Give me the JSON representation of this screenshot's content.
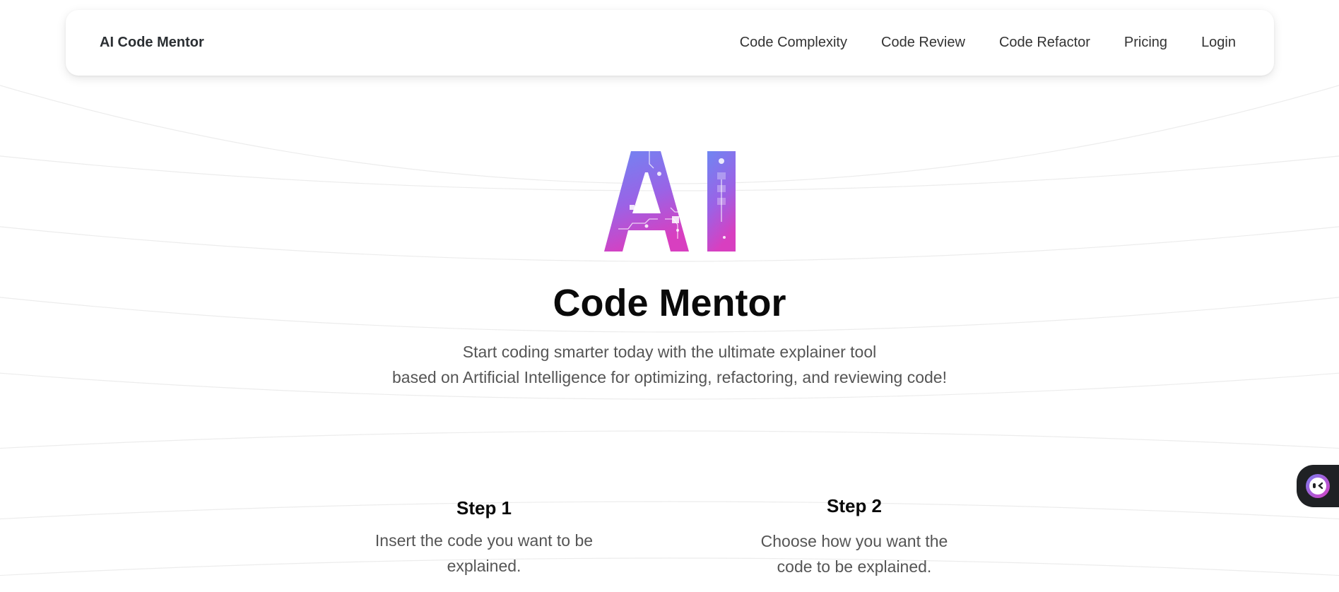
{
  "navbar": {
    "brand": "AI Code Mentor",
    "links": [
      {
        "label": "Code Complexity"
      },
      {
        "label": "Code Review"
      },
      {
        "label": "Code Refactor"
      },
      {
        "label": "Pricing"
      },
      {
        "label": "Login"
      }
    ]
  },
  "hero": {
    "logo_text": "AI",
    "title": "Code Mentor",
    "subtitle_line1": "Start coding smarter today with the ultimate explainer tool",
    "subtitle_line2": "based on Artificial Intelligence for optimizing, refactoring, and reviewing code!"
  },
  "steps": [
    {
      "title": "Step 1",
      "desc_line1": "Insert the code you want to be",
      "desc_line2": "explained."
    },
    {
      "title": "Step 2",
      "desc_line1": "Choose how you want the",
      "desc_line2": "code to be explained."
    }
  ],
  "chat_widget": {
    "icon": "chat-bot-icon"
  },
  "colors": {
    "logo_gradient_top": "#7b7cf0",
    "logo_gradient_bottom": "#d63fc2",
    "text_dark": "#0a0a0a",
    "text_muted": "#555555",
    "chat_bg": "#1f2124"
  }
}
